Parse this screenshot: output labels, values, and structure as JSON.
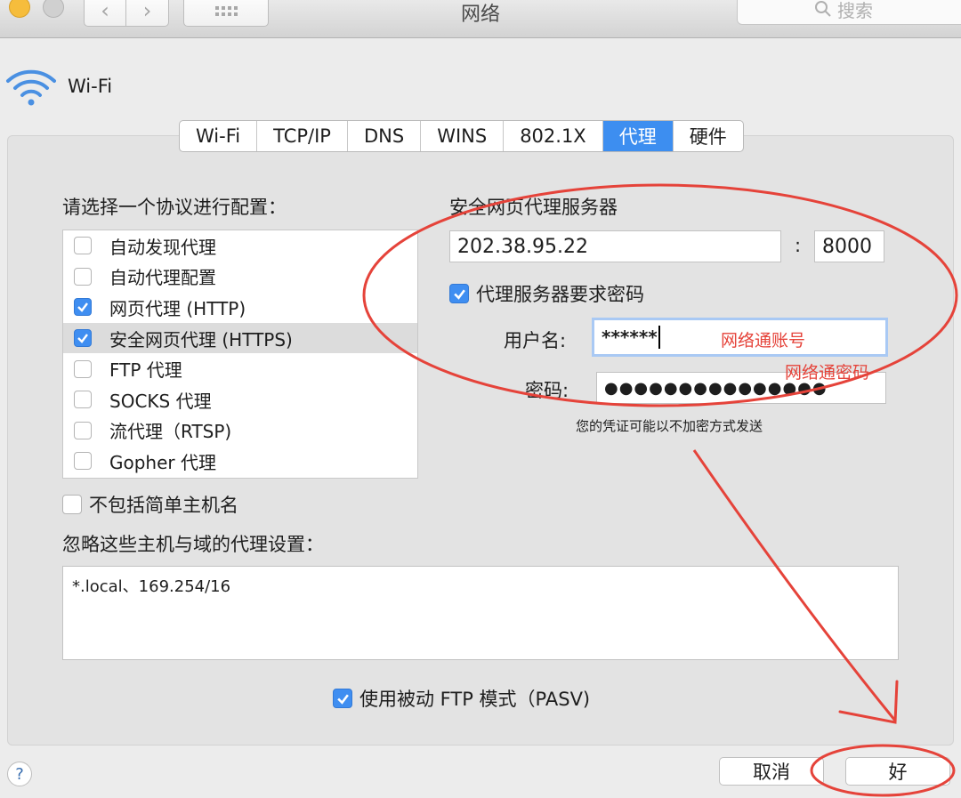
{
  "window": {
    "title": "网络",
    "search_placeholder": "搜索"
  },
  "header": {
    "title": "Wi-Fi"
  },
  "tabs": [
    {
      "label": "Wi-Fi",
      "active": false
    },
    {
      "label": "TCP/IP",
      "active": false
    },
    {
      "label": "DNS",
      "active": false
    },
    {
      "label": "WINS",
      "active": false
    },
    {
      "label": "802.1X",
      "active": false
    },
    {
      "label": "代理",
      "active": true
    },
    {
      "label": "硬件",
      "active": false
    }
  ],
  "protocols": {
    "heading": "请选择一个协议进行配置：",
    "items": [
      {
        "label": "自动发现代理",
        "checked": false
      },
      {
        "label": "自动代理配置",
        "checked": false
      },
      {
        "label": "网页代理 (HTTP)",
        "checked": true
      },
      {
        "label": "安全网页代理 (HTTPS)",
        "checked": true,
        "selected": true
      },
      {
        "label": "FTP 代理",
        "checked": false
      },
      {
        "label": "SOCKS 代理",
        "checked": false
      },
      {
        "label": "流代理（RTSP)",
        "checked": false
      },
      {
        "label": "Gopher 代理",
        "checked": false
      }
    ]
  },
  "exclude_simple": {
    "label": "不包括简单主机名",
    "checked": false
  },
  "proxy": {
    "heading": "安全网页代理服务器",
    "server": "202.38.95.22",
    "separator": ":",
    "port": "8000",
    "requires_password": {
      "label": "代理服务器要求密码",
      "checked": true
    },
    "username_label": "用户名:",
    "username": "******",
    "password_label": "密码:",
    "password": "●●●●●●●●●●●●●●●",
    "warning": "您的凭证可能以不加密方式发送"
  },
  "bypass": {
    "heading": "忽略这些主机与域的代理设置：",
    "value": "*.local、169.254/16"
  },
  "pasv": {
    "label": "使用被动 FTP 模式（PASV)",
    "checked": true
  },
  "footer": {
    "help": "?",
    "cancel": "取消",
    "ok": "好"
  },
  "annotations": {
    "account": "网络通账号",
    "password": "网络通密码",
    "color": "#e5433a"
  },
  "colors": {
    "accent": "#3d8ef0",
    "annotation": "#e5433a"
  }
}
